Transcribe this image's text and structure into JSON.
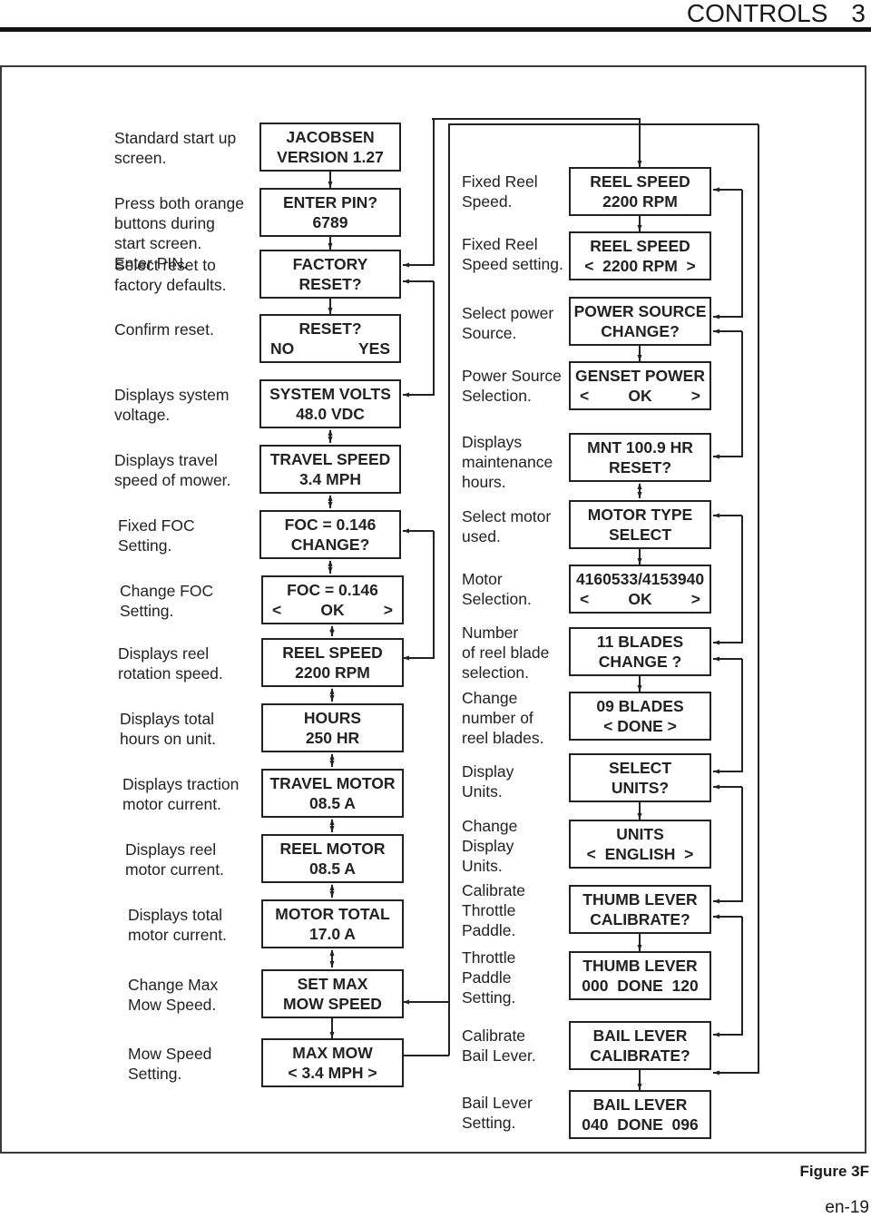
{
  "header": {
    "section": "CONTROLS",
    "chapter": "3"
  },
  "figure_label": "Figure 3F",
  "page_number": "en-19",
  "left_column": [
    {
      "label": "Standard start up\nscreen.",
      "screen": [
        "JACOBSEN",
        "VERSION 1.27"
      ]
    },
    {
      "label": "Press both orange\nbuttons during\nstart screen.\nEnter PIN.",
      "screen": [
        "ENTER PIN?",
        "6789"
      ]
    },
    {
      "label": "Select reset to\nfactory defaults.",
      "screen": [
        "FACTORY",
        "RESET?"
      ]
    },
    {
      "label": "Confirm reset.",
      "screen": [
        "RESET?",
        [
          "NO",
          "YES"
        ]
      ]
    },
    {
      "label": "Displays system\nvoltage.",
      "screen": [
        "SYSTEM VOLTS",
        "48.0 VDC"
      ]
    },
    {
      "label": "Displays travel\nspeed of mower.",
      "screen": [
        "TRAVEL SPEED",
        "3.4 MPH"
      ]
    },
    {
      "label": "Fixed FOC\nSetting.",
      "screen": [
        "FOC = 0.146",
        "CHANGE?"
      ]
    },
    {
      "label": "Change FOC\nSetting.",
      "screen": [
        "FOC = 0.146",
        [
          "<",
          "OK",
          ">"
        ]
      ]
    },
    {
      "label": "Displays reel\nrotation speed.",
      "screen": [
        "REEL SPEED",
        "2200 RPM"
      ]
    },
    {
      "label": "Displays total\nhours on unit.",
      "screen": [
        "HOURS",
        "250 HR"
      ]
    },
    {
      "label": "Displays traction\nmotor current.",
      "screen": [
        "TRAVEL MOTOR",
        "08.5 A"
      ]
    },
    {
      "label": "Displays reel\nmotor current.",
      "screen": [
        "REEL MOTOR",
        "08.5 A"
      ]
    },
    {
      "label": "Displays total\nmotor current.",
      "screen": [
        "MOTOR TOTAL",
        "17.0 A"
      ]
    },
    {
      "label": "Change Max\nMow Speed.",
      "screen": [
        "SET MAX",
        "MOW SPEED"
      ]
    },
    {
      "label": "Mow Speed\nSetting.",
      "screen": [
        "MAX MOW",
        "< 3.4 MPH >"
      ]
    }
  ],
  "right_column": [
    {
      "label": "Fixed Reel\nSpeed.",
      "screen": [
        "REEL SPEED",
        "2200 RPM"
      ]
    },
    {
      "label": "Fixed Reel\nSpeed setting.",
      "screen": [
        "REEL SPEED",
        "<  2200 RPM  >"
      ]
    },
    {
      "label": "Select power\nSource.",
      "screen": [
        "POWER SOURCE",
        "CHANGE?"
      ]
    },
    {
      "label": "Power Source\nSelection.",
      "screen": [
        "GENSET POWER",
        [
          "<",
          "OK",
          ">"
        ]
      ]
    },
    {
      "label": "Displays\nmaintenance\nhours.",
      "screen": [
        "MNT 100.9 HR",
        "RESET?"
      ]
    },
    {
      "label": "Select motor\nused.",
      "screen": [
        "MOTOR TYPE",
        "SELECT"
      ]
    },
    {
      "label": "Motor\nSelection.",
      "screen": [
        "4160533/4153940",
        [
          "<",
          "OK",
          ">"
        ]
      ]
    },
    {
      "label": "Number\nof reel blade\nselection.",
      "screen": [
        "11 BLADES",
        "CHANGE ?"
      ]
    },
    {
      "label": "Change\nnumber of\nreel blades.",
      "screen": [
        "09 BLADES",
        "< DONE >"
      ]
    },
    {
      "label": "Display\nUnits.",
      "screen": [
        "SELECT",
        "UNITS?"
      ]
    },
    {
      "label": "Change\nDisplay\nUnits.",
      "screen": [
        "UNITS",
        "<  ENGLISH  >"
      ]
    },
    {
      "label": "Calibrate\nThrottle\nPaddle.",
      "screen": [
        "THUMB LEVER",
        "CALIBRATE?"
      ]
    },
    {
      "label": "Throttle\nPaddle\nSetting.",
      "screen": [
        "THUMB LEVER",
        "000  DONE  120"
      ]
    },
    {
      "label": "Calibrate\nBail Lever.",
      "screen": [
        "BAIL LEVER",
        "CALIBRATE?"
      ]
    },
    {
      "label": "Bail Lever\nSetting.",
      "screen": [
        "BAIL LEVER",
        "040  DONE  096"
      ]
    }
  ]
}
